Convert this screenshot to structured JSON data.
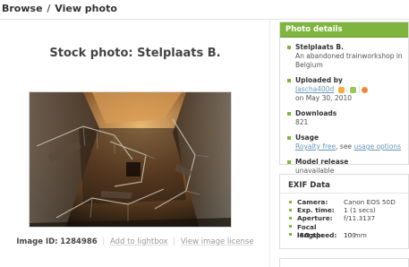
{
  "breadcrumb": {
    "items": [
      "Browse",
      "View photo"
    ],
    "separator": "/"
  },
  "photo": {
    "title": "Stock photo: Stelplaats B.",
    "image_id_label": "Image ID:",
    "image_id": "1284986",
    "add_to_lightbox": "Add to lightbox",
    "view_license": "View image license"
  },
  "details": {
    "header": "Photo details",
    "accent_color": "#7fb53e",
    "title_label": "Stelplaats B.",
    "description": "An abandoned trainworkshop in Belgium",
    "uploaded_by_label": "Uploaded by",
    "uploader": "Jascha400d",
    "uploaded_on": "on May 30, 2010",
    "downloads_label": "Downloads",
    "downloads": "821",
    "usage_label": "Usage",
    "usage_link": "Royalty free",
    "usage_see": ", see",
    "usage_options": "usage options",
    "model_release_label": "Model release",
    "model_release": "unavailable"
  },
  "exif": {
    "header": "EXIF Data",
    "rows": [
      {
        "key": "Camera:",
        "value": "Canon EOS 50D"
      },
      {
        "key": "Exp. time:",
        "value": "1 (1 secs)"
      },
      {
        "key": "Aperture:",
        "value": "f/11.3137"
      },
      {
        "key": "Focal length:",
        "value": "10 mm"
      },
      {
        "key": "ISO speed:",
        "value": "100"
      }
    ]
  }
}
